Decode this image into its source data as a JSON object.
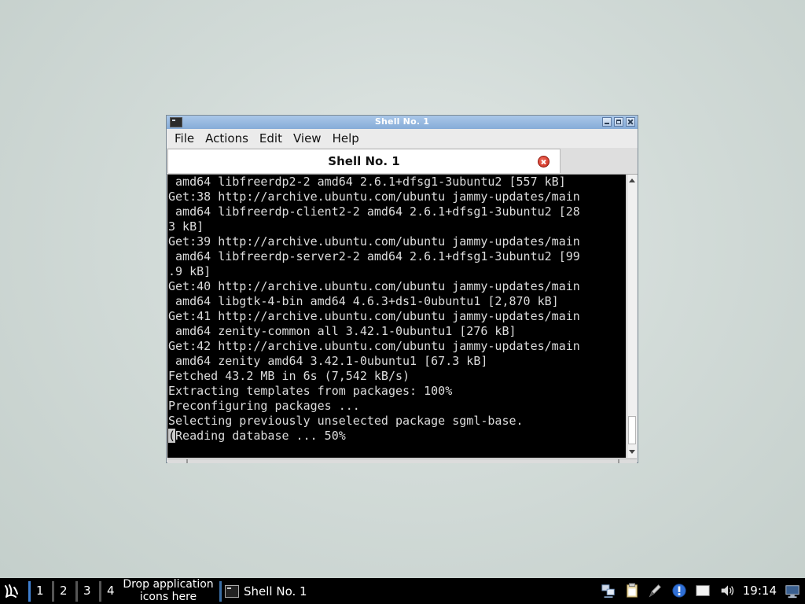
{
  "window": {
    "title": "Shell No. 1",
    "menu": [
      "File",
      "Actions",
      "Edit",
      "View",
      "Help"
    ],
    "tab_label": "Shell No. 1"
  },
  "terminal": {
    "lines": [
      " amd64 libfreerdp2-2 amd64 2.6.1+dfsg1-3ubuntu2 [557 kB]",
      "Get:38 http://archive.ubuntu.com/ubuntu jammy-updates/main",
      " amd64 libfreerdp-client2-2 amd64 2.6.1+dfsg1-3ubuntu2 [28",
      "3 kB]",
      "Get:39 http://archive.ubuntu.com/ubuntu jammy-updates/main",
      " amd64 libfreerdp-server2-2 amd64 2.6.1+dfsg1-3ubuntu2 [99",
      ".9 kB]",
      "Get:40 http://archive.ubuntu.com/ubuntu jammy-updates/main",
      " amd64 libgtk-4-bin amd64 4.6.3+ds1-0ubuntu1 [2,870 kB]",
      "Get:41 http://archive.ubuntu.com/ubuntu jammy-updates/main",
      " amd64 zenity-common all 3.42.1-0ubuntu1 [276 kB]",
      "Get:42 http://archive.ubuntu.com/ubuntu jammy-updates/main",
      " amd64 zenity amd64 3.42.1-0ubuntu1 [67.3 kB]",
      "Fetched 43.2 MB in 6s (7,542 kB/s)",
      "Extracting templates from packages: 100%",
      "Preconfiguring packages ...",
      "Selecting previously unselected package sgml-base."
    ],
    "cursor_char": "(",
    "last_line_rest": "Reading database ... 50%"
  },
  "taskbar": {
    "desktops": [
      "1",
      "2",
      "3",
      "4"
    ],
    "drop_text_line1": "Drop application",
    "drop_text_line2": "icons here",
    "task_label": "Shell No. 1",
    "clock": "19:14",
    "tray_icons": [
      "network-icon",
      "clipboard-icon",
      "pen-icon",
      "update-notifier-icon",
      "blank-window-icon",
      "volume-icon",
      "display-icon"
    ]
  },
  "colors": {
    "terminal_bg": "#000000",
    "terminal_fg": "#dcdcdc",
    "titlebar": "#9bbce2",
    "taskbar": "#000000",
    "desktop_accent": "#3f7fd0"
  }
}
